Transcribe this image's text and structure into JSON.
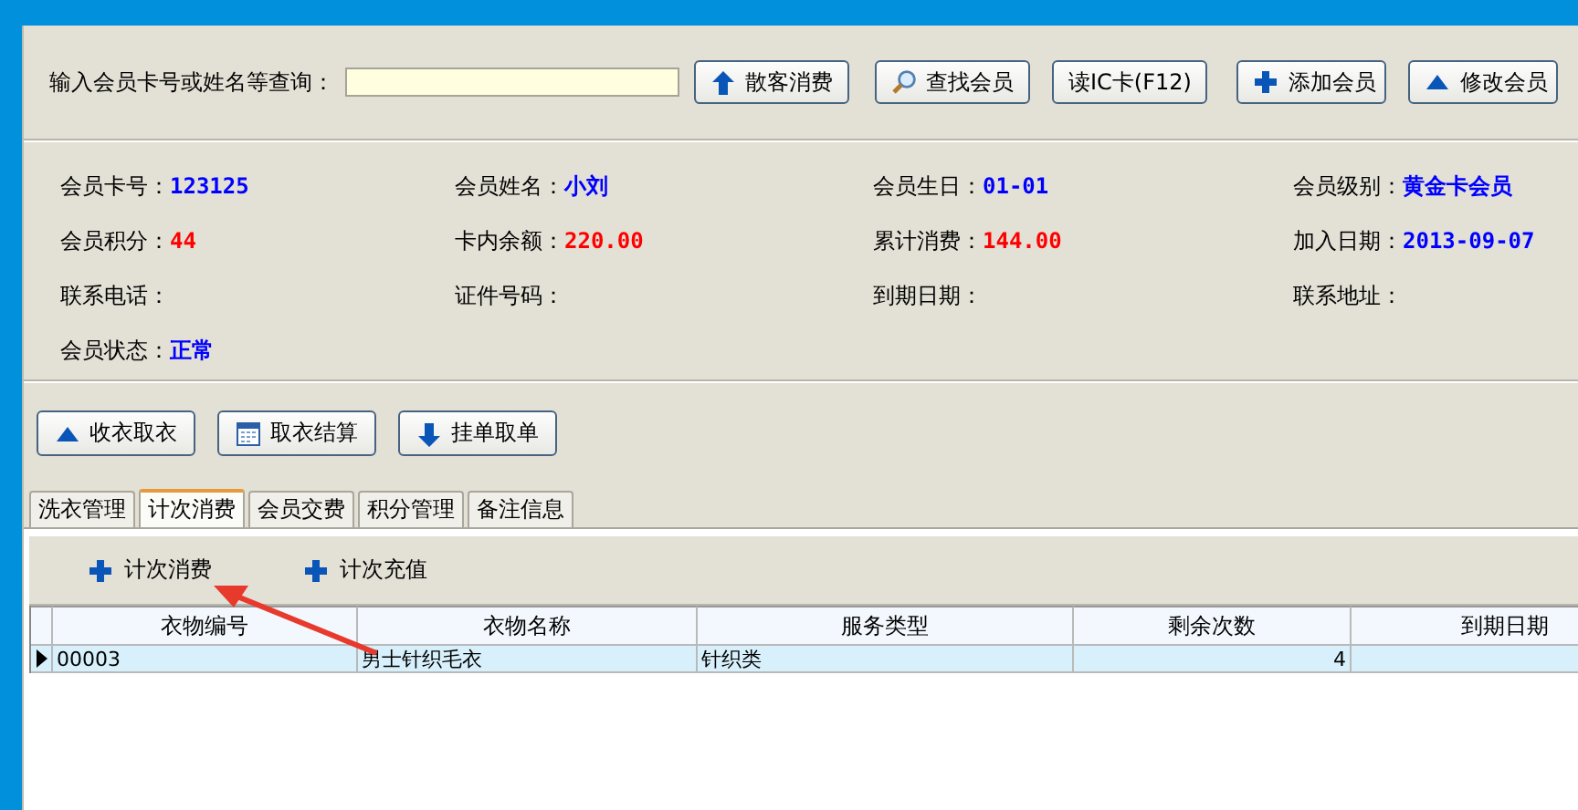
{
  "search": {
    "label": "输入会员卡号或姓名等查询：",
    "buttons": [
      "散客消费",
      "查找会员",
      "读IC卡(F12)",
      "添加会员",
      "修改会员"
    ]
  },
  "member_info": [
    {
      "label": "会员卡号：",
      "value": "123125",
      "color": "#0000ff"
    },
    {
      "label": "会员姓名：",
      "value": "小刘",
      "color": "#0000ff"
    },
    {
      "label": "会员生日：",
      "value": "01-01",
      "color": "#0000ff"
    },
    {
      "label": "会员级别：",
      "value": "黄金卡会员",
      "color": "#0000ff"
    },
    {
      "label": "会员积分：",
      "value": "44",
      "color": "#ff0000"
    },
    {
      "label": "卡内余额：",
      "value": "220.00",
      "color": "#ff0000"
    },
    {
      "label": "累计消费：",
      "value": "144.00",
      "color": "#ff0000"
    },
    {
      "label": "加入日期：",
      "value": "2013-09-07",
      "color": "#0000ff"
    },
    {
      "label": "联系电话："
    },
    {
      "label": "证件号码："
    },
    {
      "label": "到期日期："
    },
    {
      "label": "联系地址："
    },
    {
      "label": "会员状态：",
      "value": "正常",
      "color": "#0000ff"
    }
  ],
  "actions": [
    "收衣取衣",
    "取衣结算",
    "挂单取单"
  ],
  "tabs": [
    {
      "label": "洗衣管理",
      "selected": false
    },
    {
      "label": "计次消费",
      "selected": true
    },
    {
      "label": "会员交费",
      "selected": false
    },
    {
      "label": "积分管理",
      "selected": false
    },
    {
      "label": "备注信息",
      "selected": false
    }
  ],
  "toolbar": [
    "计次消费",
    "计次充值"
  ],
  "table": {
    "columns": [
      "衣物编号",
      "衣物名称",
      "服务类型",
      "剩余次数",
      "到期日期"
    ],
    "rows": [
      {
        "selected": true,
        "cells": [
          "00003",
          "男士针织毛衣",
          "针织类",
          "4"
        ]
      }
    ]
  }
}
